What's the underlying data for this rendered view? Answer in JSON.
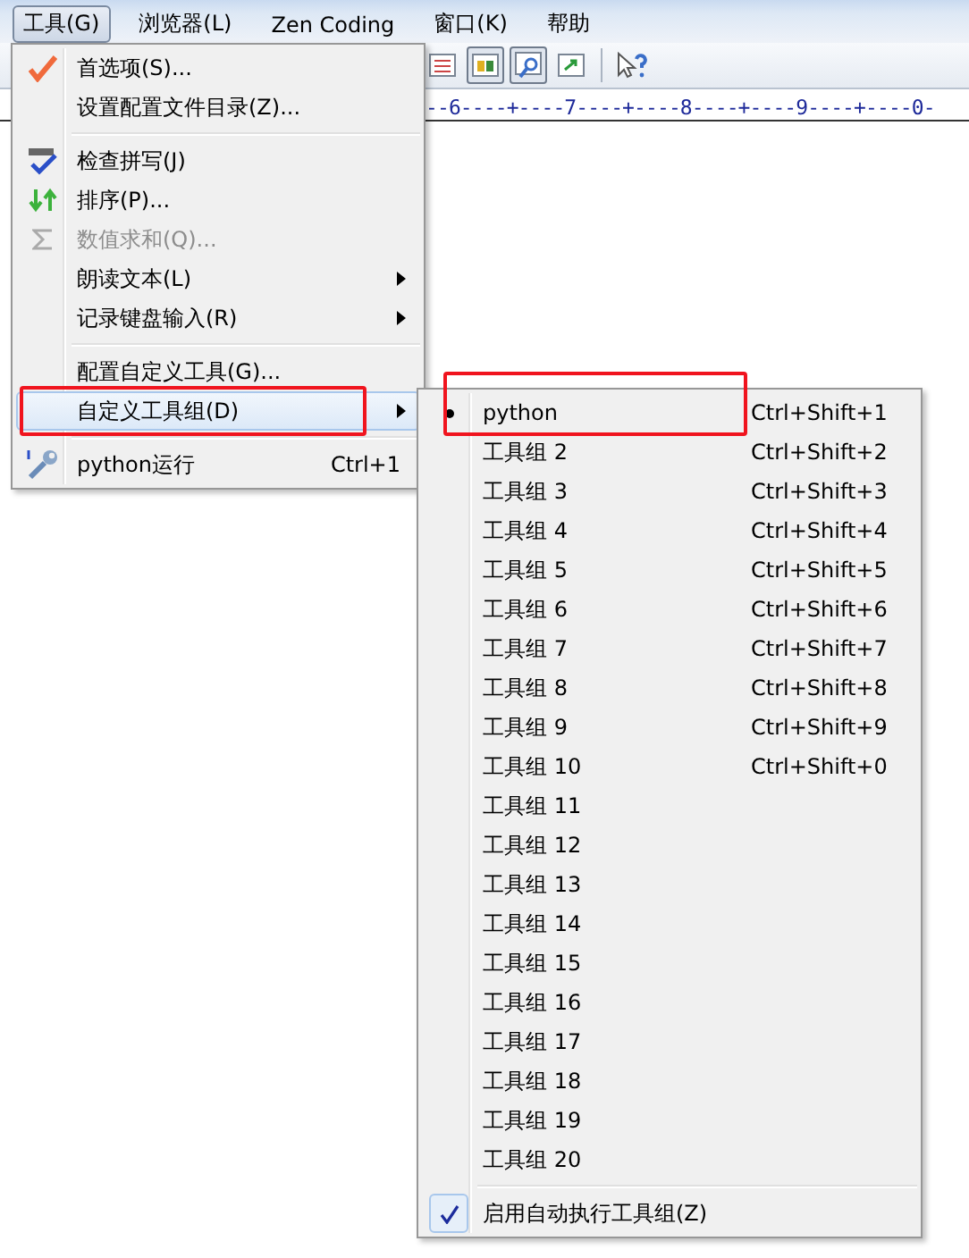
{
  "menubar": [
    {
      "label": "工具(G)",
      "selected": true
    },
    {
      "label": "浏览器(L)",
      "selected": false
    },
    {
      "label": "Zen Coding",
      "selected": false
    },
    {
      "label": "窗口(K)",
      "selected": false
    },
    {
      "label": "帮助",
      "selected": false
    }
  ],
  "toolbar": [
    {
      "kind": "list",
      "pressed": false
    },
    {
      "kind": "layout",
      "pressed": true
    },
    {
      "kind": "search",
      "pressed": true
    },
    {
      "kind": "export",
      "pressed": false
    },
    {
      "kind": "separator"
    },
    {
      "kind": "help",
      "pressed": false
    }
  ],
  "ruler": "--6----+----7----+----8----+----9----+----0-",
  "menu": [
    {
      "kind": "item",
      "label": "首选项(S)...",
      "submenu": false,
      "disabled": false,
      "selected": false,
      "highlighted": false
    },
    {
      "kind": "item",
      "label": "设置配置文件目录(Z)...",
      "submenu": false,
      "disabled": false,
      "selected": false,
      "highlighted": false
    },
    {
      "kind": "separator"
    },
    {
      "kind": "item",
      "label": "检查拼写(J)",
      "submenu": false,
      "disabled": false,
      "selected": false,
      "highlighted": false
    },
    {
      "kind": "item",
      "label": "排序(P)...",
      "submenu": false,
      "disabled": false,
      "selected": false,
      "highlighted": false
    },
    {
      "kind": "item",
      "label": "数值求和(Q)...",
      "submenu": false,
      "disabled": true,
      "selected": false,
      "highlighted": false
    },
    {
      "kind": "item",
      "label": "朗读文本(L)",
      "submenu": true,
      "disabled": false,
      "selected": false,
      "highlighted": false
    },
    {
      "kind": "item",
      "label": "记录键盘输入(R)",
      "submenu": true,
      "disabled": false,
      "selected": false,
      "highlighted": false
    },
    {
      "kind": "separator"
    },
    {
      "kind": "item",
      "label": "配置自定义工具(G)...",
      "submenu": false,
      "disabled": false,
      "selected": false,
      "highlighted": false
    },
    {
      "kind": "item",
      "label": "自定义工具组(D)",
      "submenu": true,
      "disabled": false,
      "selected": true,
      "highlighted": true
    },
    {
      "kind": "separator"
    },
    {
      "kind": "item",
      "label": "python运行",
      "shortcut": "Ctrl+1",
      "submenu": false,
      "disabled": false,
      "selected": false,
      "highlighted": false
    }
  ],
  "submenu": [
    {
      "kind": "radio",
      "label": "python",
      "shortcut": "Ctrl+Shift+1",
      "selected": true,
      "highlighted": true
    },
    {
      "kind": "radio",
      "label": "工具组 2",
      "shortcut": "Ctrl+Shift+2",
      "selected": false,
      "highlighted": false
    },
    {
      "kind": "radio",
      "label": "工具组 3",
      "shortcut": "Ctrl+Shift+3",
      "selected": false,
      "highlighted": false
    },
    {
      "kind": "radio",
      "label": "工具组 4",
      "shortcut": "Ctrl+Shift+4",
      "selected": false,
      "highlighted": false
    },
    {
      "kind": "radio",
      "label": "工具组 5",
      "shortcut": "Ctrl+Shift+5",
      "selected": false,
      "highlighted": false
    },
    {
      "kind": "radio",
      "label": "工具组 6",
      "shortcut": "Ctrl+Shift+6",
      "selected": false,
      "highlighted": false
    },
    {
      "kind": "radio",
      "label": "工具组 7",
      "shortcut": "Ctrl+Shift+7",
      "selected": false,
      "highlighted": false
    },
    {
      "kind": "radio",
      "label": "工具组 8",
      "shortcut": "Ctrl+Shift+8",
      "selected": false,
      "highlighted": false
    },
    {
      "kind": "radio",
      "label": "工具组 9",
      "shortcut": "Ctrl+Shift+9",
      "selected": false,
      "highlighted": false
    },
    {
      "kind": "radio",
      "label": "工具组 10",
      "shortcut": "Ctrl+Shift+0",
      "selected": false,
      "highlighted": false
    },
    {
      "kind": "radio",
      "label": "工具组 11",
      "selected": false,
      "highlighted": false
    },
    {
      "kind": "radio",
      "label": "工具组 12",
      "selected": false,
      "highlighted": false
    },
    {
      "kind": "radio",
      "label": "工具组 13",
      "selected": false,
      "highlighted": false
    },
    {
      "kind": "radio",
      "label": "工具组 14",
      "selected": false,
      "highlighted": false
    },
    {
      "kind": "radio",
      "label": "工具组 15",
      "selected": false,
      "highlighted": false
    },
    {
      "kind": "radio",
      "label": "工具组 16",
      "selected": false,
      "highlighted": false
    },
    {
      "kind": "radio",
      "label": "工具组 17",
      "selected": false,
      "highlighted": false
    },
    {
      "kind": "radio",
      "label": "工具组 18",
      "selected": false,
      "highlighted": false
    },
    {
      "kind": "radio",
      "label": "工具组 19",
      "selected": false,
      "highlighted": false
    },
    {
      "kind": "radio",
      "label": "工具组 20",
      "selected": false,
      "highlighted": false
    },
    {
      "kind": "separator"
    },
    {
      "kind": "toggle",
      "label": "启用自动执行工具组(Z)",
      "checked": true
    }
  ]
}
